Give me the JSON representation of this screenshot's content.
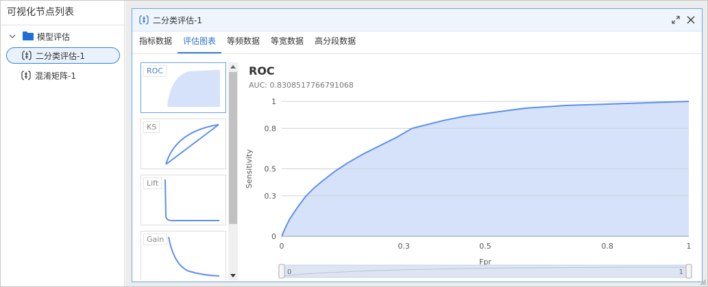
{
  "left_panel": {
    "title": "可视化节点列表",
    "folder": {
      "label": "模型评估"
    },
    "items": [
      {
        "label": "二分类评估-1",
        "selected": true
      },
      {
        "label": "混淆矩阵-1",
        "selected": false
      }
    ]
  },
  "dialog": {
    "title": "二分类评估-1",
    "tabs": [
      {
        "label": "指标数据",
        "active": false
      },
      {
        "label": "评估图表",
        "active": true
      },
      {
        "label": "等频数据",
        "active": false
      },
      {
        "label": "等宽数据",
        "active": false
      },
      {
        "label": "高分段数据",
        "active": false
      }
    ],
    "thumbnails": [
      {
        "label": "ROC",
        "active": true
      },
      {
        "label": "KS",
        "active": false
      },
      {
        "label": "Lift",
        "active": false
      },
      {
        "label": "Gain",
        "active": false
      }
    ]
  },
  "colors": {
    "accent": "#3a7fd5",
    "curve": "#5b8ff0",
    "fill": "#d6e2f9"
  },
  "slider": {
    "start_label": "0",
    "end_label": "1"
  },
  "chart_data": {
    "type": "area",
    "title": "ROC",
    "subtitle": "AUC: 0.8308517766791068",
    "xlabel": "Fpr",
    "ylabel": "Sensitivity",
    "xlim": [
      0,
      1
    ],
    "ylim": [
      0,
      1
    ],
    "x_ticks": [
      "0",
      "0.3",
      "0.5",
      "0.8",
      "1"
    ],
    "y_ticks": [
      "0",
      "0.3",
      "0.5",
      "0.8",
      "1"
    ],
    "grid": true,
    "x": [
      0,
      0.01,
      0.02,
      0.04,
      0.06,
      0.08,
      0.1,
      0.13,
      0.16,
      0.2,
      0.24,
      0.28,
      0.32,
      0.36,
      0.4,
      0.45,
      0.5,
      0.55,
      0.6,
      0.7,
      0.8,
      0.9,
      1
    ],
    "y": [
      0,
      0.07,
      0.13,
      0.22,
      0.3,
      0.36,
      0.41,
      0.48,
      0.54,
      0.61,
      0.67,
      0.73,
      0.8,
      0.83,
      0.86,
      0.89,
      0.91,
      0.93,
      0.95,
      0.97,
      0.98,
      0.99,
      1
    ]
  }
}
